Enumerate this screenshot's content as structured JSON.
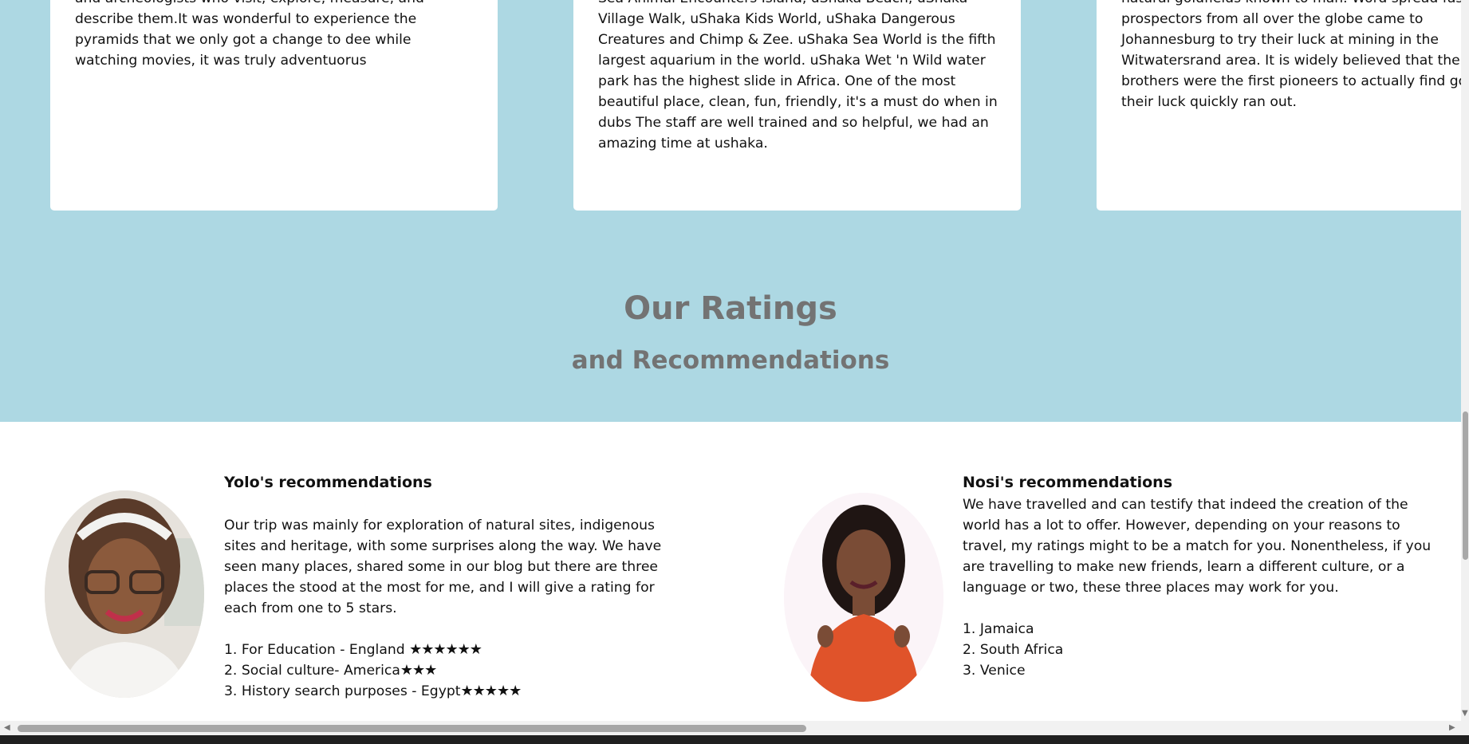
{
  "cards": [
    {
      "text": "and archeologists who visit, explore, measure, and describe them.It was wonderful to experience the pyramids that we only got a change to dee while watching movies, it was truly adventuorus"
    },
    {
      "text": "Sea Animal Encounters Island, uShaka Beach, uShaka Village Walk, uShaka Kids World, uShaka Dangerous Creatures and Chimp & Zee. uShaka Sea World is the fifth largest aquarium in the world. uShaka Wet 'n Wild water park has the highest slide in Africa. One of the most beautiful place, clean, fun, friendly, it's a must do when in dubs The staff are well trained and so helpful, we had an amazing time at ushaka."
    },
    {
      "text": "natural goldfields known to man. Word spread fast prospectors from all over the globe came to Johannesburg to try their luck at mining in the Witwatersrand area. It is widely believed that the brothers were the first pioneers to actually find go their luck quickly ran out."
    }
  ],
  "ratings": {
    "title": "Our Ratings",
    "subtitle": "and Recommendations"
  },
  "yolo": {
    "heading": "Yolo's recommendations",
    "text": "Our trip was mainly for exploration of natural sites, indigenous sites and heritage, with some surprises along the way. We have seen many places, shared some in our blog but there are three places the stood at the most for me, and I will give a rating for each from one to 5 stars.",
    "items": [
      {
        "label": "1. For Education - England ",
        "stars": "★★★★★★"
      },
      {
        "label": "2. Social culture- America",
        "stars": "★★★"
      },
      {
        "label": "3. History search purposes - Egypt",
        "stars": "★★★★★"
      }
    ]
  },
  "nosi": {
    "heading": "Nosi's recommendations",
    "text": "We have travelled and can testify that indeed the creation of the world has a lot to offer. However, depending on your reasons to travel, my ratings might to be a match for you. Nonentheless, if you are travelling to make new friends, learn a different culture, or a language or two, these three places may work for you.",
    "items": [
      {
        "label": "1. Jamaica"
      },
      {
        "label": "2. South Africa"
      },
      {
        "label": "3. Venice"
      }
    ]
  },
  "colors": {
    "band": "#add8e3",
    "heading_gray": "#737373"
  }
}
